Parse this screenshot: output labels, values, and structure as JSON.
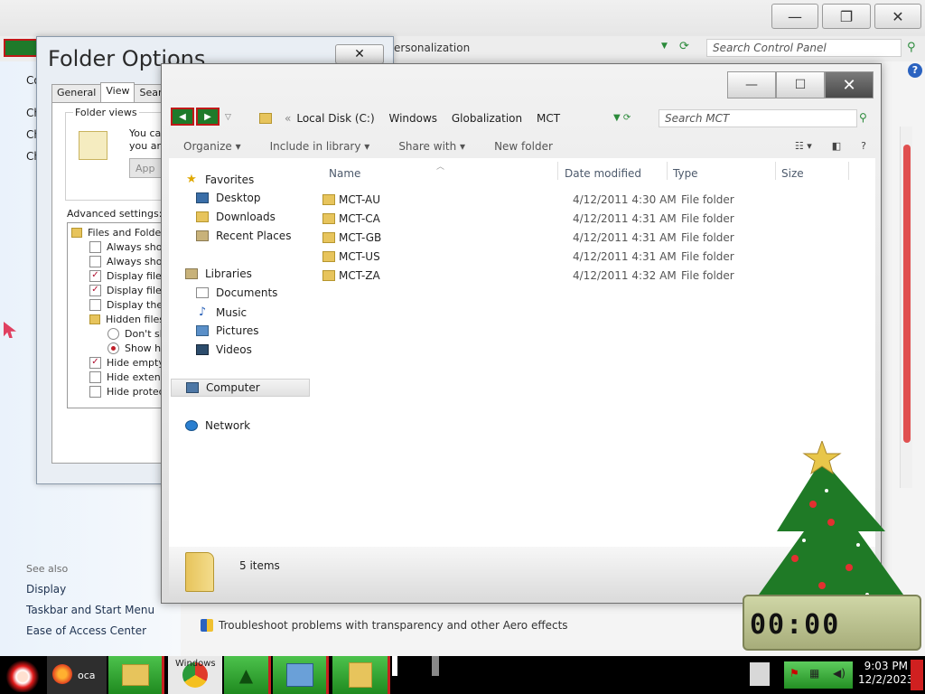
{
  "control_panel": {
    "breadcrumb": "ersonalization",
    "search_placeholder": "Search Control Panel",
    "left_partial": [
      "Co",
      "Ch",
      "Ch",
      "Ch"
    ],
    "see_also": "See also",
    "links": [
      "Display",
      "Taskbar and Start Menu",
      "Ease of Access Center"
    ],
    "troubleshoot": "Troubleshoot problems with transparency and other Aero effects",
    "help": "?"
  },
  "folder_options": {
    "title": "Folder Options",
    "tabs": [
      "General",
      "View",
      "Searc"
    ],
    "active_tab": "View",
    "folder_views_label": "Folder views",
    "folder_views_text": [
      "You car",
      "you are"
    ],
    "apply_button": "App",
    "advanced_label": "Advanced settings:",
    "tree": [
      {
        "kind": "folder",
        "label": "Files and Folders"
      },
      {
        "kind": "checkbox",
        "checked": false,
        "label": "Always show"
      },
      {
        "kind": "checkbox",
        "checked": false,
        "label": "Always show"
      },
      {
        "kind": "checkbox",
        "checked": true,
        "label": "Display file ic"
      },
      {
        "kind": "checkbox",
        "checked": true,
        "label": "Display file siz"
      },
      {
        "kind": "checkbox",
        "checked": false,
        "label": "Display the fu"
      },
      {
        "kind": "folder",
        "label": "Hidden files a"
      },
      {
        "kind": "radio",
        "checked": false,
        "label": "Don't sho"
      },
      {
        "kind": "radio",
        "checked": true,
        "label": "Show hid"
      },
      {
        "kind": "checkbox",
        "checked": true,
        "label": "Hide empty d"
      },
      {
        "kind": "checkbox",
        "checked": false,
        "label": "Hide extensio"
      },
      {
        "kind": "checkbox",
        "checked": false,
        "label": "Hide protecte"
      }
    ]
  },
  "explorer": {
    "address": [
      "Local Disk (C:)",
      "Windows",
      "Globalization",
      "MCT"
    ],
    "address_chevron": "«",
    "search_placeholder": "Search MCT",
    "commands": [
      "Organize ▾",
      "Include in library ▾",
      "Share with ▾",
      "New folder"
    ],
    "nav": {
      "favorites": "Favorites",
      "favorites_items": [
        "Desktop",
        "Downloads",
        "Recent Places"
      ],
      "libraries": "Libraries",
      "libraries_items": [
        "Documents",
        "Music",
        "Pictures",
        "Videos"
      ],
      "computer": "Computer",
      "network": "Network"
    },
    "columns": [
      "Name",
      "Date modified",
      "Type",
      "Size"
    ],
    "files": [
      {
        "name": "MCT-AU",
        "date": "4/12/2011 4:30 AM",
        "type": "File folder"
      },
      {
        "name": "MCT-CA",
        "date": "4/12/2011 4:31 AM",
        "type": "File folder"
      },
      {
        "name": "MCT-GB",
        "date": "4/12/2011 4:31 AM",
        "type": "File folder"
      },
      {
        "name": "MCT-US",
        "date": "4/12/2011 4:31 AM",
        "type": "File folder"
      },
      {
        "name": "MCT-ZA",
        "date": "4/12/2011 4:32 AM",
        "type": "File folder"
      }
    ],
    "item_count": "5 items"
  },
  "taskbar": {
    "items": [
      "oca",
      "Windows"
    ],
    "time": "9:03 PM",
    "date": "12/2/2023"
  },
  "gadget": {
    "digits": "00:00"
  },
  "colors": {
    "accent_green": "#1f8a1f",
    "accent_red": "#c82020",
    "folder_yellow": "#e7c45c"
  }
}
